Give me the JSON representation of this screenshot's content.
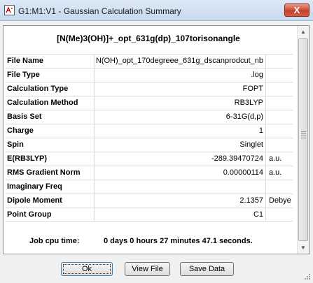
{
  "window": {
    "title": "G1:M1:V1 - Gaussian Calculation Summary",
    "close_label": "X"
  },
  "summary": {
    "job_name": "[N(Me)3(OH)]+_opt_631g(dp)_107torisonangle",
    "rows": [
      {
        "label": "File Name",
        "value": "N(OH)_opt_170degreee_631g_dscanprodcut_nb",
        "unit": ""
      },
      {
        "label": "File Type",
        "value": ".log",
        "unit": ""
      },
      {
        "label": "Calculation Type",
        "value": "FOPT",
        "unit": ""
      },
      {
        "label": "Calculation Method",
        "value": "RB3LYP",
        "unit": ""
      },
      {
        "label": "Basis Set",
        "value": "6-31G(d,p)",
        "unit": ""
      },
      {
        "label": "Charge",
        "value": "1",
        "unit": ""
      },
      {
        "label": "Spin",
        "value": "Singlet",
        "unit": ""
      },
      {
        "label": "E(RB3LYP)",
        "value": "-289.39470724",
        "unit": "a.u."
      },
      {
        "label": "RMS Gradient Norm",
        "value": "0.00000114",
        "unit": "a.u."
      },
      {
        "label": "Imaginary Freq",
        "value": "",
        "unit": ""
      },
      {
        "label": "Dipole Moment",
        "value": "2.1357",
        "unit": "Debye"
      },
      {
        "label": "Point Group",
        "value": "C1",
        "unit": ""
      }
    ],
    "cpu_label": "Job cpu time:",
    "cpu_value": "0 days  0 hours 27 minutes 47.1 seconds."
  },
  "buttons": {
    "ok": "Ok",
    "view_file": "View File",
    "save_data": "Save Data"
  },
  "icons": {
    "app": "gaussian-app-icon",
    "close": "close-icon",
    "scroll_up": "scroll-up-arrow-icon",
    "scroll_down": "scroll-down-arrow-icon"
  }
}
